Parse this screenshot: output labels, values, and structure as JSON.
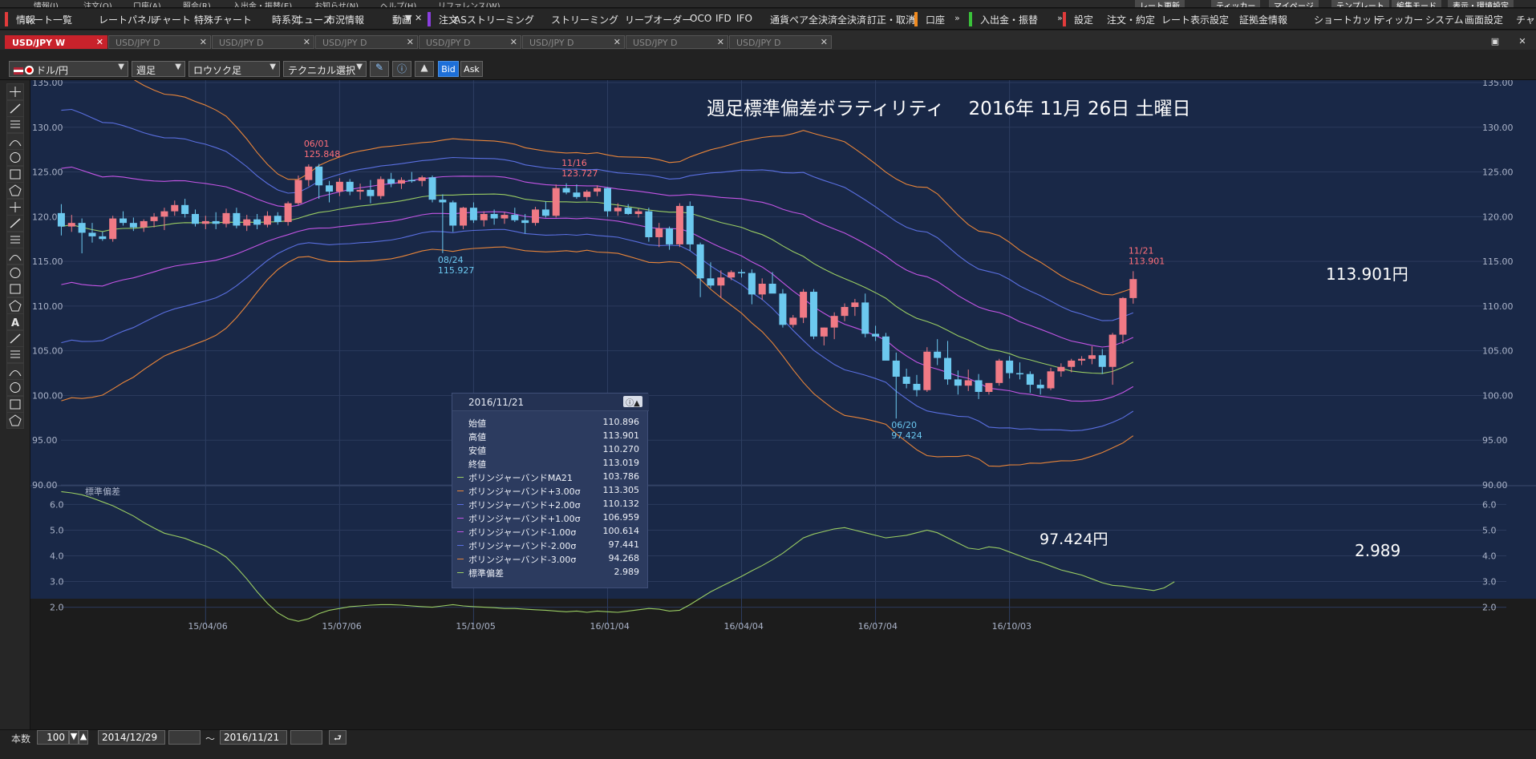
{
  "menubar": {
    "items": [
      "情報(I)",
      "注文(O)",
      "口座(A)",
      "照会(R)",
      "入出金・振替(E)",
      "お知らせ(N)",
      "ヘルプ(H)",
      "リファレンス(W)"
    ],
    "right_items": [
      "レート更新",
      "ティッカー",
      "マイページ",
      "テンプレート",
      "編集モード",
      "表示・環境設定"
    ]
  },
  "toolbar": {
    "group1": [
      "情報",
      "レート一覧",
      "レートパネル",
      "チャート",
      "特殊チャート",
      "時系列",
      "ニュース",
      "市況情報",
      "動画"
    ],
    "group2": [
      "注文",
      "ASストリーミング",
      "ストリーミング",
      "リーブオーダー",
      "OCO",
      "IFD",
      "IFO",
      "通貨ペア全決済",
      "全決済",
      "訂正・取消"
    ],
    "group3": [
      "口座"
    ],
    "group4": [
      "入出金・振替"
    ],
    "group5": [
      "設定",
      "注文・約定",
      "レート表示設定",
      "証拠金情報",
      "ショートカット",
      "ティッカー",
      "システム",
      "画面設定",
      "チャート"
    ],
    "colors": {
      "group1": "#e23b3b",
      "group2": "#8b3fe0",
      "group3": "#f08a1f",
      "group4": "#3ac23a",
      "group5": "#e23b3b"
    }
  },
  "tabs": [
    {
      "label": "USD/JPY W",
      "active": true
    },
    {
      "label": "USD/JPY D",
      "active": false
    },
    {
      "label": "USD/JPY D",
      "active": false
    },
    {
      "label": "USD/JPY D",
      "active": false
    },
    {
      "label": "USD/JPY D",
      "active": false
    },
    {
      "label": "USD/JPY D",
      "active": false
    },
    {
      "label": "USD/JPY D",
      "active": false
    },
    {
      "label": "USD/JPY D",
      "active": false
    }
  ],
  "controls": {
    "pair": "ドル/円",
    "period": "週足",
    "chart_type": "ロウソク足",
    "technical": "テクニカル選択",
    "bid": "Bid",
    "ask": "Ask"
  },
  "chart_overlays": {
    "title": "週足標準偏差ボラティリティ　 2016年 11月 26日 土曜日",
    "price_high": "113.901円",
    "price_low": "97.424円",
    "stddev_value": "2.989",
    "sub_label": "標準偏差"
  },
  "annotations": [
    {
      "date": "06/01",
      "price": "125.848",
      "color": "#ff6f7a"
    },
    {
      "date": "08/24",
      "price": "115.927",
      "color": "#6bc8f0"
    },
    {
      "date": "11/16",
      "price": "123.727",
      "color": "#ff6f7a"
    },
    {
      "date": "06/20",
      "price": "97.424",
      "color": "#6bc8f0"
    },
    {
      "date": "11/21",
      "price": "113.901",
      "color": "#ff6f7a"
    }
  ],
  "infobox": {
    "date": "2016/11/21",
    "rows": [
      {
        "label": "始値",
        "value": "110.896",
        "color": ""
      },
      {
        "label": "高値",
        "value": "113.901",
        "color": ""
      },
      {
        "label": "安値",
        "value": "110.270",
        "color": ""
      },
      {
        "label": "終値",
        "value": "113.019",
        "color": ""
      },
      {
        "label": "ボリンジャーバンドMA21",
        "value": "103.786",
        "color": "#9acd63"
      },
      {
        "label": "ボリンジャーバンド+3.00σ",
        "value": "113.305",
        "color": "#e8853a"
      },
      {
        "label": "ボリンジャーバンド+2.00σ",
        "value": "110.132",
        "color": "#5a6fe0"
      },
      {
        "label": "ボリンジャーバンド+1.00σ",
        "value": "106.959",
        "color": "#c455e6"
      },
      {
        "label": "ボリンジャーバンド-1.00σ",
        "value": "100.614",
        "color": "#c455e6"
      },
      {
        "label": "ボリンジャーバンド-2.00σ",
        "value": "97.441",
        "color": "#5a6fe0"
      },
      {
        "label": "ボリンジャーバンド-3.00σ",
        "value": "94.268",
        "color": "#e8853a"
      },
      {
        "label": "標準偏差",
        "value": "2.989",
        "color": "#9acd63"
      }
    ]
  },
  "bottom": {
    "count_label": "本数",
    "count": "100",
    "from_date": "2014/12/29",
    "tilde": "～",
    "to_date": "2016/11/21"
  },
  "chart_data": [
    {
      "type": "candlestick",
      "title": "週足標準偏差ボラティリティ　 2016年 11月 26日 土曜日",
      "yticks": [
        "135.00",
        "130.00",
        "125.00",
        "120.00",
        "115.00",
        "110.00",
        "105.00",
        "100.00",
        "95.00",
        "90.00"
      ],
      "ylim": [
        90,
        135
      ],
      "x_labels": [
        "15/04/06",
        "15/07/06",
        "15/10/05",
        "16/01/04",
        "16/04/04",
        "16/07/04",
        "16/10/03"
      ],
      "x_label_index": [
        14,
        27,
        40,
        53,
        66,
        79,
        92
      ],
      "candles": [
        [
          120.4,
          121.4,
          117.9,
          118.9
        ],
        [
          118.9,
          120.2,
          118.3,
          119.3
        ],
        [
          119.3,
          119.8,
          115.9,
          118.2
        ],
        [
          118.2,
          119.3,
          117.1,
          117.8
        ],
        [
          117.8,
          118.3,
          117.3,
          117.5
        ],
        [
          117.5,
          120.1,
          117.2,
          119.8
        ],
        [
          119.8,
          120.6,
          119.0,
          119.3
        ],
        [
          119.3,
          119.9,
          118.4,
          118.8
        ],
        [
          118.8,
          119.7,
          118.3,
          119.5
        ],
        [
          119.5,
          120.4,
          118.8,
          120.0
        ],
        [
          120.0,
          121.0,
          118.5,
          120.6
        ],
        [
          120.6,
          121.8,
          120.1,
          121.3
        ],
        [
          121.3,
          122.0,
          119.9,
          120.3
        ],
        [
          120.3,
          120.8,
          118.9,
          119.2
        ],
        [
          119.2,
          120.1,
          118.6,
          119.5
        ],
        [
          119.5,
          120.5,
          118.6,
          119.2
        ],
        [
          119.2,
          120.9,
          118.8,
          120.4
        ],
        [
          120.4,
          121.0,
          118.7,
          119.0
        ],
        [
          119.0,
          120.2,
          118.4,
          119.7
        ],
        [
          119.7,
          120.3,
          118.6,
          119.1
        ],
        [
          119.1,
          120.6,
          118.8,
          120.1
        ],
        [
          120.1,
          120.5,
          119.1,
          119.4
        ],
        [
          119.4,
          121.7,
          119.0,
          121.5
        ],
        [
          121.5,
          124.6,
          121.3,
          124.1
        ],
        [
          124.1,
          125.848,
          123.4,
          125.6
        ],
        [
          125.6,
          125.9,
          122.0,
          123.5
        ],
        [
          123.5,
          124.0,
          121.6,
          122.8
        ],
        [
          122.8,
          124.3,
          122.3,
          123.9
        ],
        [
          123.9,
          124.2,
          122.4,
          122.8
        ],
        [
          122.8,
          123.7,
          121.9,
          123.0
        ],
        [
          123.0,
          124.1,
          121.5,
          122.3
        ],
        [
          122.3,
          124.5,
          122.0,
          124.2
        ],
        [
          124.2,
          124.9,
          123.3,
          123.7
        ],
        [
          123.7,
          124.4,
          123.1,
          124.1
        ],
        [
          124.1,
          125.0,
          123.8,
          124.0
        ],
        [
          124.0,
          124.6,
          123.4,
          124.4
        ],
        [
          124.4,
          124.6,
          121.6,
          121.9
        ],
        [
          121.9,
          122.5,
          115.927,
          121.6
        ],
        [
          121.6,
          121.8,
          118.3,
          119.0
        ],
        [
          119.0,
          121.1,
          118.6,
          121.0
        ],
        [
          121.0,
          121.6,
          119.3,
          119.6
        ],
        [
          119.6,
          120.6,
          118.9,
          120.3
        ],
        [
          120.3,
          120.8,
          119.1,
          119.8
        ],
        [
          119.8,
          120.5,
          119.2,
          120.2
        ],
        [
          120.2,
          121.0,
          119.4,
          119.6
        ],
        [
          119.6,
          120.3,
          118.1,
          119.3
        ],
        [
          119.3,
          121.1,
          119.0,
          120.8
        ],
        [
          120.8,
          121.7,
          119.9,
          120.1
        ],
        [
          120.1,
          123.6,
          119.9,
          123.2
        ],
        [
          123.2,
          123.727,
          122.5,
          122.7
        ],
        [
          122.7,
          123.6,
          122.0,
          122.2
        ],
        [
          122.2,
          123.0,
          121.8,
          122.8
        ],
        [
          122.8,
          123.5,
          122.3,
          123.2
        ],
        [
          123.2,
          123.3,
          120.0,
          120.6
        ],
        [
          120.6,
          121.5,
          120.1,
          121.0
        ],
        [
          121.0,
          121.4,
          120.2,
          120.3
        ],
        [
          120.3,
          120.9,
          119.9,
          120.6
        ],
        [
          120.6,
          121.0,
          117.2,
          117.7
        ],
        [
          117.7,
          119.3,
          116.6,
          118.7
        ],
        [
          118.7,
          118.9,
          116.3,
          116.9
        ],
        [
          116.9,
          121.5,
          116.6,
          121.2
        ],
        [
          121.2,
          121.7,
          116.2,
          116.9
        ],
        [
          116.9,
          117.1,
          111.0,
          113.1
        ],
        [
          113.1,
          114.9,
          112.0,
          112.3
        ],
        [
          112.3,
          114.0,
          110.9,
          113.2
        ],
        [
          113.2,
          114.0,
          112.9,
          113.8
        ],
        [
          113.8,
          114.1,
          113.2,
          113.7
        ],
        [
          113.7,
          114.1,
          110.2,
          111.3
        ],
        [
          111.3,
          113.1,
          110.7,
          112.5
        ],
        [
          112.5,
          113.8,
          111.5,
          111.4
        ],
        [
          111.4,
          111.9,
          107.6,
          107.9
        ],
        [
          107.9,
          109.0,
          107.6,
          108.7
        ],
        [
          108.7,
          111.9,
          108.1,
          111.6
        ],
        [
          111.6,
          111.9,
          106.3,
          106.6
        ],
        [
          106.6,
          107.6,
          105.6,
          107.6
        ],
        [
          107.6,
          109.3,
          106.3,
          108.9
        ],
        [
          108.9,
          110.3,
          108.3,
          109.9
        ],
        [
          109.9,
          110.8,
          108.9,
          110.4
        ],
        [
          110.4,
          111.4,
          106.5,
          106.9
        ],
        [
          106.9,
          107.8,
          106.1,
          106.6
        ],
        [
          106.6,
          107.0,
          104.6,
          103.9
        ],
        [
          103.9,
          104.8,
          97.424,
          102.1
        ],
        [
          102.1,
          103.0,
          100.8,
          101.3
        ],
        [
          101.3,
          102.3,
          99.9,
          100.6
        ],
        [
          100.6,
          105.4,
          100.4,
          104.9
        ],
        [
          104.9,
          106.3,
          103.4,
          104.2
        ],
        [
          104.2,
          106.1,
          101.2,
          101.8
        ],
        [
          101.8,
          102.8,
          100.1,
          101.1
        ],
        [
          101.1,
          102.9,
          100.5,
          101.7
        ],
        [
          101.7,
          102.4,
          99.6,
          100.4
        ],
        [
          100.4,
          101.2,
          100.1,
          101.4
        ],
        [
          101.4,
          104.1,
          101.1,
          103.9
        ],
        [
          103.9,
          104.4,
          101.9,
          102.5
        ],
        [
          102.5,
          103.7,
          101.8,
          102.4
        ],
        [
          102.4,
          102.7,
          100.3,
          101.2
        ],
        [
          101.2,
          101.8,
          100.1,
          100.8
        ],
        [
          100.8,
          103.1,
          100.6,
          102.7
        ],
        [
          102.7,
          103.6,
          102.1,
          103.2
        ],
        [
          103.2,
          104.1,
          102.6,
          103.9
        ],
        [
          103.9,
          104.4,
          103.4,
          104.1
        ],
        [
          104.1,
          105.5,
          103.5,
          104.5
        ],
        [
          104.5,
          105.2,
          102.4,
          103.2
        ],
        [
          103.2,
          107.0,
          101.2,
          106.8
        ],
        [
          106.8,
          111.0,
          105.8,
          110.9
        ],
        [
          110.896,
          113.901,
          110.27,
          113.019
        ]
      ],
      "bands": {
        "ma21_first": 112.0,
        "ma21_last": 103.786,
        "plus3_last": 113.305,
        "plus2_last": 110.132,
        "plus1_last": 106.959,
        "minus1_last": 100.614,
        "minus2_last": 97.441,
        "minus3_last": 94.268
      }
    },
    {
      "type": "line",
      "title": "標準偏差",
      "yticks": [
        "6.0",
        "5.0",
        "4.0",
        "3.0",
        "2.0"
      ],
      "ylim": [
        1.3,
        6.7
      ],
      "values": [
        6.5,
        6.45,
        6.38,
        6.25,
        6.1,
        5.95,
        5.75,
        5.55,
        5.3,
        5.08,
        4.88,
        4.78,
        4.68,
        4.52,
        4.38,
        4.2,
        3.95,
        3.55,
        3.1,
        2.6,
        2.15,
        1.78,
        1.55,
        1.45,
        1.55,
        1.75,
        1.88,
        1.95,
        2.02,
        2.05,
        2.08,
        2.1,
        2.1,
        2.08,
        2.05,
        2.02,
        2.0,
        2.05,
        2.1,
        2.05,
        2.02,
        2.0,
        1.98,
        1.95,
        1.95,
        1.92,
        1.9,
        1.88,
        1.85,
        1.82,
        1.85,
        1.8,
        1.85,
        1.82,
        1.8,
        1.85,
        1.9,
        1.95,
        1.92,
        1.85,
        1.88,
        2.1,
        2.35,
        2.6,
        2.8,
        3.0,
        3.2,
        3.42,
        3.62,
        3.85,
        4.1,
        4.4,
        4.7,
        4.85,
        4.95,
        5.05,
        5.1,
        5.0,
        4.9,
        4.8,
        4.7,
        4.75,
        4.8,
        4.9,
        5.0,
        4.9,
        4.7,
        4.5,
        4.3,
        4.25,
        4.35,
        4.3,
        4.15,
        4.0,
        3.85,
        3.75,
        3.6,
        3.45,
        3.35,
        3.25,
        3.1,
        2.95,
        2.85,
        2.82,
        2.75,
        2.7,
        2.65,
        2.75,
        2.989
      ]
    }
  ]
}
